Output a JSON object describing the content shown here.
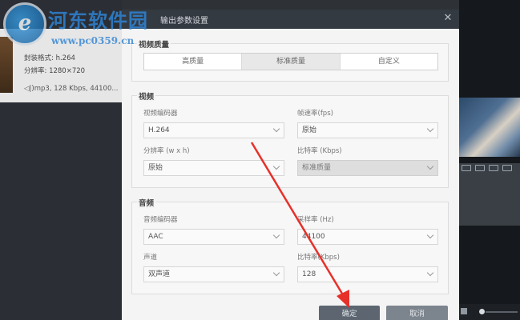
{
  "background": {
    "format_label": "封装格式: h.264",
    "resolution_label": "分辨率: 1280×720",
    "audio_info": "◁|)mp3, 128 Kbps, 44100..."
  },
  "watermark": {
    "logo_glyph": "e",
    "site_name": "河东软件园",
    "url": "www.pc0359.cn"
  },
  "dialog": {
    "title": "输出参数设置",
    "close_glyph": "✕",
    "quality": {
      "title": "视频质量",
      "tabs": [
        "高质量",
        "标准质量",
        "自定义"
      ],
      "active_index": 1
    },
    "video": {
      "title": "视频",
      "encoder_label": "视频编码器",
      "encoder_value": "H.264",
      "fps_label": "帧速率(fps)",
      "fps_value": "原始",
      "resolution_label": "分辨率 (w x h)",
      "resolution_value": "原始",
      "bitrate_label": "比特率 (Kbps)",
      "bitrate_value": "标准质量"
    },
    "audio": {
      "title": "音频",
      "encoder_label": "音频编码器",
      "encoder_value": "AAC",
      "samplerate_label": "采样率 (Hz)",
      "samplerate_value": "44100",
      "channel_label": "声道",
      "channel_value": "双声道",
      "bitrate_label": "比特率(Kbps)",
      "bitrate_value": "128"
    },
    "ok_label": "确定",
    "cancel_label": "取消"
  },
  "colors": {
    "dialog_titlebar": "#343a42",
    "ok_button": "#5d6670",
    "cancel_button": "#7c848d",
    "annotation_arrow": "#e8302a",
    "watermark_blue": "#2f83d4"
  },
  "icons": [
    "close-icon",
    "chevron-down-icon",
    "red-arrow-annotation"
  ]
}
